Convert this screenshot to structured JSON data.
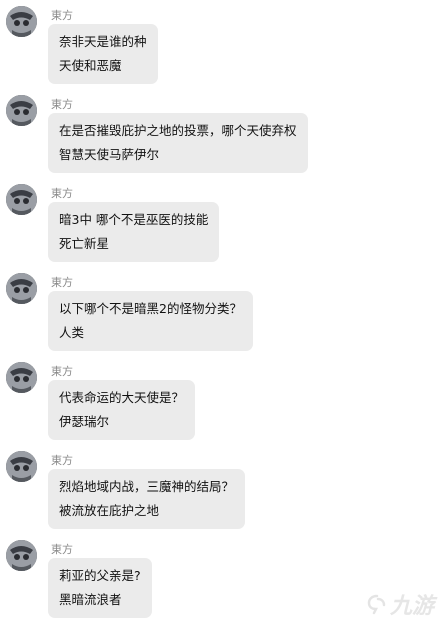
{
  "sender": "東方",
  "messages": [
    {
      "lines": [
        "奈非天是谁的种",
        "天使和恶魔"
      ]
    },
    {
      "lines": [
        "在是否摧毁庇护之地的投票，哪个天使弃权",
        "智慧天使马萨伊尔"
      ]
    },
    {
      "lines": [
        "暗3中 哪个不是巫医的技能",
        "死亡新星"
      ]
    },
    {
      "lines": [
        "以下哪个不是暗黑2的怪物分类？",
        "人类"
      ]
    },
    {
      "lines": [
        "代表命运的大天使是？",
        "伊瑟瑞尔"
      ]
    },
    {
      "lines": [
        "烈焰地域内战，三魔神的结局？",
        "被流放在庇护之地"
      ]
    },
    {
      "lines": [
        "莉亚的父亲是?",
        "黑暗流浪者"
      ]
    }
  ],
  "watermark": {
    "text": "九游",
    "icon": "nine-game-logo-icon"
  }
}
